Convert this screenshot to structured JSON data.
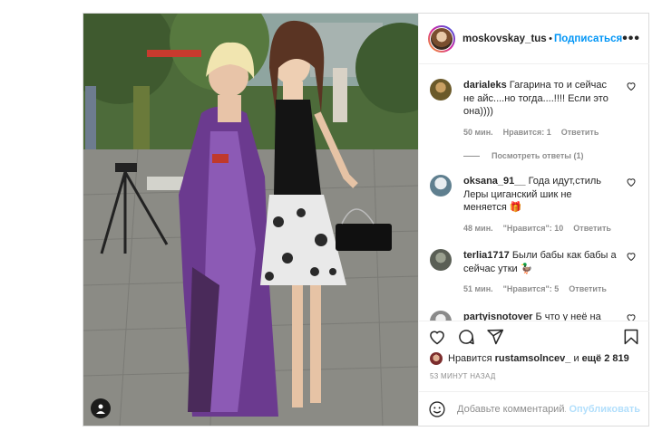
{
  "post": {
    "username": "moskovskay_tusovk",
    "dot": "•",
    "follow_label": "Подписаться",
    "more_label": "•••"
  },
  "comments": [
    {
      "user": "darialeks",
      "text": "Гагарина то и сейчас не айс....но тогда....!!!! Если это она))))",
      "time": "50 мин.",
      "likes": "Нравится: 1",
      "reply": "Ответить",
      "avatar_color": "#6b5a2a",
      "replies": "Посмотреть ответы (1)"
    },
    {
      "user": "oksana_91__",
      "text": "Года идут,стиль Леры циганский шик не меняется 🎁",
      "time": "48 мин.",
      "likes": "\"Нравится\": 10",
      "reply": "Ответить",
      "avatar_color": "#5f7f8f"
    },
    {
      "user": "terlia1717",
      "text": "Были бабы как бабы а сейчас утки 🦆",
      "time": "51 мин.",
      "likes": "\"Нравится\": 5",
      "reply": "Ответить",
      "avatar_color": "#5a5f55"
    },
    {
      "user": "partyisnotover",
      "text": "Б      что у неё на голове ? 😩",
      "time": "",
      "likes": "",
      "reply": "",
      "avatar_color": "#8a8a8a"
    }
  ],
  "likes_line": {
    "prefix": "Нравится",
    "user": "rustamsolncev_",
    "conj": "и",
    "count": "ещё 2 819"
  },
  "timestamp": "53 МИНУТ НАЗАД",
  "add_comment": {
    "placeholder": "Добавьте комментарий...",
    "publish_label": "Опубликовать"
  },
  "colors": {
    "accent": "#0095f6",
    "publish_disabled": "#b2dffc",
    "muted": "#8e8e8e",
    "border": "#dbdbdb"
  },
  "icons": [
    "heart-icon",
    "comment-icon",
    "share-icon",
    "bookmark-icon",
    "emoji-icon",
    "user-tag-icon",
    "more-icon"
  ]
}
